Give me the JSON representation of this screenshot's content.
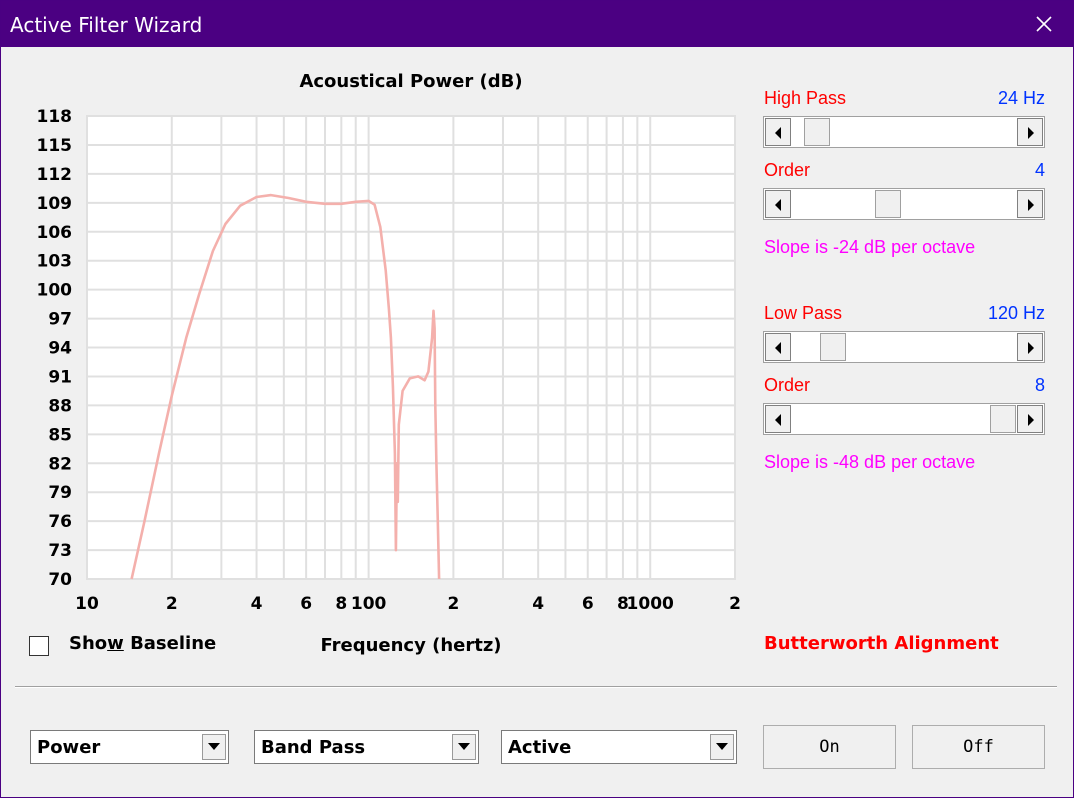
{
  "window": {
    "title": "Active Filter Wizard"
  },
  "chart_data": {
    "type": "line",
    "title": "Acoustical Power (dB)",
    "xlabel": "Frequency (hertz)",
    "ylabel": "",
    "xscale": "log",
    "xlim": [
      10,
      2000
    ],
    "ylim": [
      70,
      118
    ],
    "grid": true,
    "x_tick_labels": [
      {
        "value": 10,
        "label": "10"
      },
      {
        "value": 20,
        "label": "2"
      },
      {
        "value": 40,
        "label": "4"
      },
      {
        "value": 60,
        "label": "6"
      },
      {
        "value": 80,
        "label": "8"
      },
      {
        "value": 100,
        "label": "100"
      },
      {
        "value": 200,
        "label": "2"
      },
      {
        "value": 400,
        "label": "4"
      },
      {
        "value": 600,
        "label": "6"
      },
      {
        "value": 800,
        "label": "8"
      },
      {
        "value": 1000,
        "label": "1000"
      },
      {
        "value": 2000,
        "label": "2"
      }
    ],
    "y_ticks": [
      118,
      115,
      112,
      109,
      106,
      103,
      100,
      97,
      94,
      91,
      88,
      85,
      82,
      79,
      76,
      73,
      70
    ],
    "grid_x": [
      20,
      30,
      40,
      50,
      60,
      70,
      80,
      90,
      100,
      200,
      300,
      400,
      500,
      600,
      700,
      800,
      900,
      1000
    ],
    "grid_y": [
      115,
      112,
      109,
      106,
      103,
      100,
      97,
      94,
      91,
      88,
      85,
      82,
      79,
      76,
      73
    ],
    "series": [
      {
        "color": "#f4b0ac",
        "points": [
          [
            14.4,
            70
          ],
          [
            16,
            76
          ],
          [
            18,
            83
          ],
          [
            20,
            89
          ],
          [
            22.5,
            95
          ],
          [
            25,
            99.5
          ],
          [
            28,
            104
          ],
          [
            31,
            106.8
          ],
          [
            35,
            108.7
          ],
          [
            40,
            109.6
          ],
          [
            45,
            109.8
          ],
          [
            52,
            109.5
          ],
          [
            60,
            109.1
          ],
          [
            70,
            108.9
          ],
          [
            80,
            108.9
          ],
          [
            90,
            109.1
          ],
          [
            100,
            109.2
          ],
          [
            105,
            108.8
          ],
          [
            110,
            106.5
          ],
          [
            115,
            102
          ],
          [
            118,
            98
          ],
          [
            120,
            95
          ],
          [
            122,
            90
          ],
          [
            124,
            83
          ],
          [
            125,
            73
          ],
          [
            126,
            82
          ],
          [
            127,
            78
          ],
          [
            128,
            86
          ],
          [
            132,
            89.5
          ],
          [
            140,
            90.8
          ],
          [
            150,
            91
          ],
          [
            158,
            90.6
          ],
          [
            163,
            91.5
          ],
          [
            168,
            95
          ],
          [
            170,
            97.8
          ],
          [
            171.5,
            96
          ],
          [
            172.5,
            88
          ],
          [
            174,
            82
          ],
          [
            176,
            76
          ],
          [
            178,
            70
          ]
        ]
      }
    ]
  },
  "baseline": {
    "label_pre": "Sho",
    "label_key": "w",
    "label_post": " Baseline",
    "checked": false
  },
  "high_pass": {
    "label": "High Pass",
    "value": "24 Hz",
    "position": 0.06,
    "order_label": "Order",
    "order_value": "4",
    "order_position": 0.42,
    "slope_text": "Slope is -24 dB per octave"
  },
  "low_pass": {
    "label": "Low Pass",
    "value": "120 Hz",
    "position": 0.14,
    "order_label": "Order",
    "order_value": "8",
    "order_position": 1.0,
    "slope_text": "Slope is -48 dB per octave"
  },
  "alignment": "Butterworth Alignment",
  "combos": {
    "mode": "Power",
    "type": "Band Pass",
    "filter": "Active"
  },
  "buttons": {
    "on": "On",
    "off": "Off"
  },
  "colors": {
    "title_bar": "#4b0082",
    "curve": "#f4b0ac",
    "label_red": "#ff0000",
    "value_blue": "#0033ff",
    "slope_magenta": "#ff00ff"
  }
}
